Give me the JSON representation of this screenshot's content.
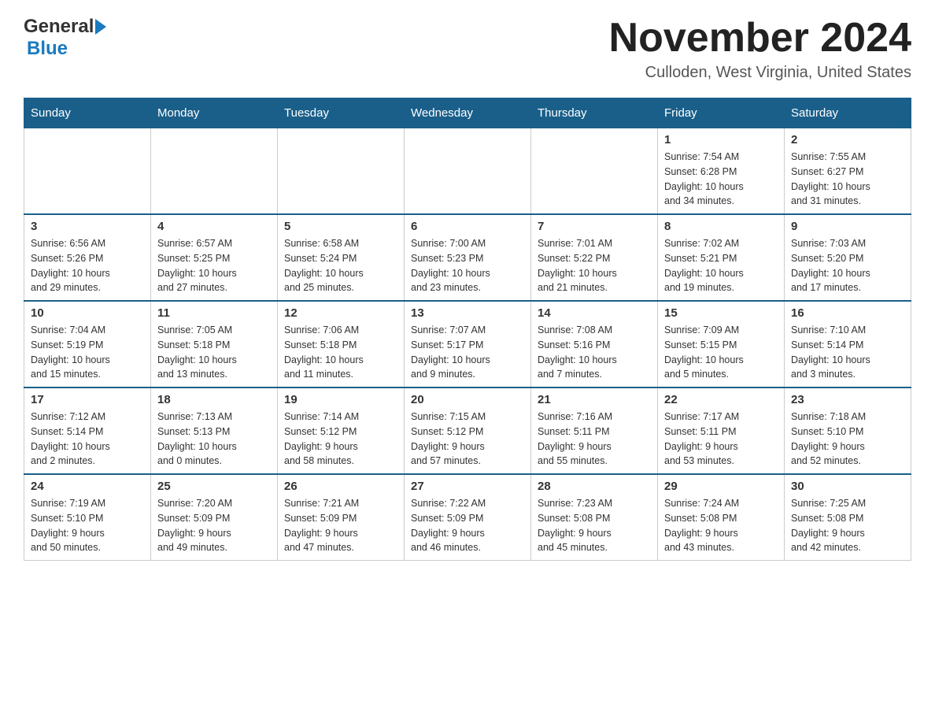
{
  "header": {
    "logo_general": "General",
    "logo_blue": "Blue",
    "title": "November 2024",
    "subtitle": "Culloden, West Virginia, United States"
  },
  "days_of_week": [
    "Sunday",
    "Monday",
    "Tuesday",
    "Wednesday",
    "Thursday",
    "Friday",
    "Saturday"
  ],
  "weeks": [
    [
      {
        "day": "",
        "info": ""
      },
      {
        "day": "",
        "info": ""
      },
      {
        "day": "",
        "info": ""
      },
      {
        "day": "",
        "info": ""
      },
      {
        "day": "",
        "info": ""
      },
      {
        "day": "1",
        "info": "Sunrise: 7:54 AM\nSunset: 6:28 PM\nDaylight: 10 hours\nand 34 minutes."
      },
      {
        "day": "2",
        "info": "Sunrise: 7:55 AM\nSunset: 6:27 PM\nDaylight: 10 hours\nand 31 minutes."
      }
    ],
    [
      {
        "day": "3",
        "info": "Sunrise: 6:56 AM\nSunset: 5:26 PM\nDaylight: 10 hours\nand 29 minutes."
      },
      {
        "day": "4",
        "info": "Sunrise: 6:57 AM\nSunset: 5:25 PM\nDaylight: 10 hours\nand 27 minutes."
      },
      {
        "day": "5",
        "info": "Sunrise: 6:58 AM\nSunset: 5:24 PM\nDaylight: 10 hours\nand 25 minutes."
      },
      {
        "day": "6",
        "info": "Sunrise: 7:00 AM\nSunset: 5:23 PM\nDaylight: 10 hours\nand 23 minutes."
      },
      {
        "day": "7",
        "info": "Sunrise: 7:01 AM\nSunset: 5:22 PM\nDaylight: 10 hours\nand 21 minutes."
      },
      {
        "day": "8",
        "info": "Sunrise: 7:02 AM\nSunset: 5:21 PM\nDaylight: 10 hours\nand 19 minutes."
      },
      {
        "day": "9",
        "info": "Sunrise: 7:03 AM\nSunset: 5:20 PM\nDaylight: 10 hours\nand 17 minutes."
      }
    ],
    [
      {
        "day": "10",
        "info": "Sunrise: 7:04 AM\nSunset: 5:19 PM\nDaylight: 10 hours\nand 15 minutes."
      },
      {
        "day": "11",
        "info": "Sunrise: 7:05 AM\nSunset: 5:18 PM\nDaylight: 10 hours\nand 13 minutes."
      },
      {
        "day": "12",
        "info": "Sunrise: 7:06 AM\nSunset: 5:18 PM\nDaylight: 10 hours\nand 11 minutes."
      },
      {
        "day": "13",
        "info": "Sunrise: 7:07 AM\nSunset: 5:17 PM\nDaylight: 10 hours\nand 9 minutes."
      },
      {
        "day": "14",
        "info": "Sunrise: 7:08 AM\nSunset: 5:16 PM\nDaylight: 10 hours\nand 7 minutes."
      },
      {
        "day": "15",
        "info": "Sunrise: 7:09 AM\nSunset: 5:15 PM\nDaylight: 10 hours\nand 5 minutes."
      },
      {
        "day": "16",
        "info": "Sunrise: 7:10 AM\nSunset: 5:14 PM\nDaylight: 10 hours\nand 3 minutes."
      }
    ],
    [
      {
        "day": "17",
        "info": "Sunrise: 7:12 AM\nSunset: 5:14 PM\nDaylight: 10 hours\nand 2 minutes."
      },
      {
        "day": "18",
        "info": "Sunrise: 7:13 AM\nSunset: 5:13 PM\nDaylight: 10 hours\nand 0 minutes."
      },
      {
        "day": "19",
        "info": "Sunrise: 7:14 AM\nSunset: 5:12 PM\nDaylight: 9 hours\nand 58 minutes."
      },
      {
        "day": "20",
        "info": "Sunrise: 7:15 AM\nSunset: 5:12 PM\nDaylight: 9 hours\nand 57 minutes."
      },
      {
        "day": "21",
        "info": "Sunrise: 7:16 AM\nSunset: 5:11 PM\nDaylight: 9 hours\nand 55 minutes."
      },
      {
        "day": "22",
        "info": "Sunrise: 7:17 AM\nSunset: 5:11 PM\nDaylight: 9 hours\nand 53 minutes."
      },
      {
        "day": "23",
        "info": "Sunrise: 7:18 AM\nSunset: 5:10 PM\nDaylight: 9 hours\nand 52 minutes."
      }
    ],
    [
      {
        "day": "24",
        "info": "Sunrise: 7:19 AM\nSunset: 5:10 PM\nDaylight: 9 hours\nand 50 minutes."
      },
      {
        "day": "25",
        "info": "Sunrise: 7:20 AM\nSunset: 5:09 PM\nDaylight: 9 hours\nand 49 minutes."
      },
      {
        "day": "26",
        "info": "Sunrise: 7:21 AM\nSunset: 5:09 PM\nDaylight: 9 hours\nand 47 minutes."
      },
      {
        "day": "27",
        "info": "Sunrise: 7:22 AM\nSunset: 5:09 PM\nDaylight: 9 hours\nand 46 minutes."
      },
      {
        "day": "28",
        "info": "Sunrise: 7:23 AM\nSunset: 5:08 PM\nDaylight: 9 hours\nand 45 minutes."
      },
      {
        "day": "29",
        "info": "Sunrise: 7:24 AM\nSunset: 5:08 PM\nDaylight: 9 hours\nand 43 minutes."
      },
      {
        "day": "30",
        "info": "Sunrise: 7:25 AM\nSunset: 5:08 PM\nDaylight: 9 hours\nand 42 minutes."
      }
    ]
  ]
}
